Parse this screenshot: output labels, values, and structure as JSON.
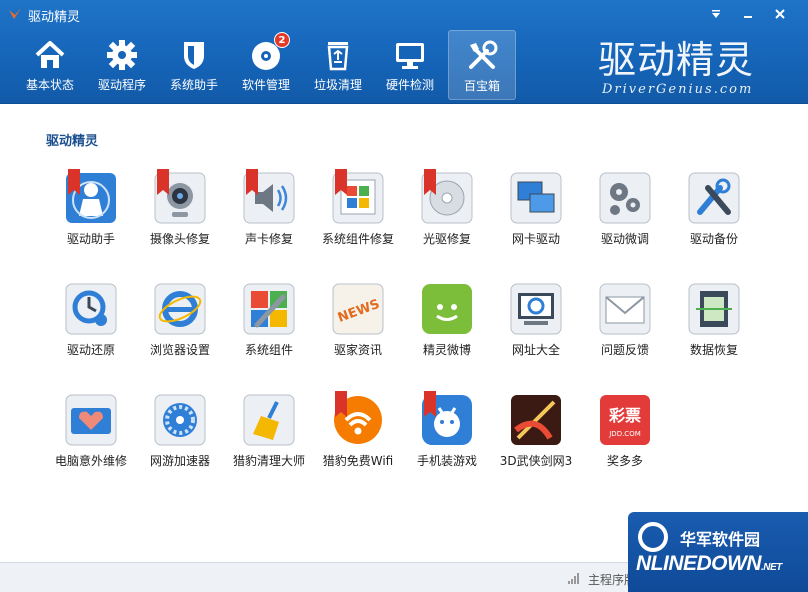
{
  "window": {
    "title": "驱动精灵"
  },
  "nav": [
    {
      "label": "基本状态",
      "icon": "home-icon"
    },
    {
      "label": "驱动程序",
      "icon": "gear-icon"
    },
    {
      "label": "系统助手",
      "icon": "shield-icon"
    },
    {
      "label": "软件管理",
      "icon": "disc-icon",
      "badge": "2"
    },
    {
      "label": "垃圾清理",
      "icon": "recycle-icon"
    },
    {
      "label": "硬件检测",
      "icon": "monitor-icon"
    },
    {
      "label": "百宝箱",
      "icon": "tools-icon",
      "active": true
    }
  ],
  "brand": {
    "cn": "驱动精灵",
    "en": "DriverGenius.com"
  },
  "section": {
    "title": "驱动精灵"
  },
  "tools": [
    {
      "name": "驱动助手",
      "icon": "driver-assistant-icon",
      "new": true
    },
    {
      "name": "摄像头修复",
      "icon": "webcam-icon",
      "new": true
    },
    {
      "name": "声卡修复",
      "icon": "speaker-icon",
      "new": true
    },
    {
      "name": "系统组件修复",
      "icon": "windows-components-icon",
      "new": true
    },
    {
      "name": "光驱修复",
      "icon": "optical-drive-icon",
      "new": true
    },
    {
      "name": "网卡驱动",
      "icon": "network-card-icon",
      "new": false
    },
    {
      "name": "驱动微调",
      "icon": "gears-icon",
      "new": false
    },
    {
      "name": "驱动备份",
      "icon": "wrench-backup-icon",
      "new": false
    },
    {
      "name": "驱动还原",
      "icon": "restore-icon",
      "new": false
    },
    {
      "name": "浏览器设置",
      "icon": "browser-icon",
      "new": false
    },
    {
      "name": "系统组件",
      "icon": "system-components-icon",
      "new": false
    },
    {
      "name": "驱家资讯",
      "icon": "news-icon",
      "new": false,
      "badge_text": "NEWS"
    },
    {
      "name": "精灵微博",
      "icon": "android-chat-icon",
      "new": false
    },
    {
      "name": "网址大全",
      "icon": "web-directory-icon",
      "new": false
    },
    {
      "name": "问题反馈",
      "icon": "envelope-icon",
      "new": false
    },
    {
      "name": "数据恢复",
      "icon": "data-recovery-icon",
      "new": false
    },
    {
      "name": "电脑意外维修",
      "icon": "heart-repair-icon",
      "new": false
    },
    {
      "name": "网游加速器",
      "icon": "accelerator-icon",
      "new": false
    },
    {
      "name": "猎豹清理大师",
      "icon": "broom-icon",
      "new": false
    },
    {
      "name": "猎豹免费Wifi",
      "icon": "wifi-icon",
      "new": true
    },
    {
      "name": "手机装游戏",
      "icon": "phone-game-icon",
      "new": true
    },
    {
      "name": "3D武侠剑网3",
      "icon": "sword-game-icon",
      "new": false
    },
    {
      "name": "奖多多",
      "icon": "lottery-icon",
      "new": false,
      "badge_text": "彩票",
      "sub_text": "JDD.COM"
    }
  ],
  "new_tag": "NEW",
  "status": {
    "text": "主程序版"
  },
  "watermark": {
    "cn": "华军软件园",
    "en": "NLINEDOWN",
    "net": ".NET"
  },
  "colors": {
    "header": "#1564b8",
    "accent": "#1b4f8f",
    "badge": "#e43a2a"
  }
}
